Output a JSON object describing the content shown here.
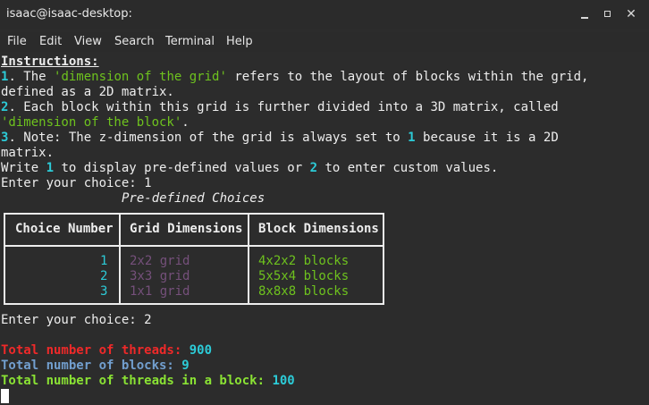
{
  "window": {
    "title": "isaac@isaac-desktop:",
    "close_glyph": "✕"
  },
  "menu": [
    "File",
    "Edit",
    "View",
    "Search",
    "Terminal",
    "Help"
  ],
  "terminal": {
    "instructions_heading": "Instructions:",
    "line1": {
      "num": "1",
      "sep": ". The ",
      "term": "'dimension of the grid'",
      "rest": " refers to the layout of blocks within the grid,"
    },
    "line1b": "defined as a 2D matrix.",
    "line2": {
      "num": "2",
      "rest": ". Each block within this grid is further divided into a 3D matrix, called"
    },
    "line2b": "'dimension of the block'",
    "line2b_end": ".",
    "line3": {
      "num": "3",
      "pre": ". Note: The z-dimension of the grid is always set to ",
      "val": "1",
      "rest": " because it is a 2D"
    },
    "line3b": "matrix.",
    "write_line": {
      "pre": "Write ",
      "one": "1",
      "mid": " to display pre-defined values or ",
      "two": "2",
      "post": " to enter custom values."
    },
    "prompt1": "Enter your choice: 1",
    "table_title": "Pre-defined Choices",
    "table": {
      "headers": [
        "Choice Number",
        "Grid Dimensions",
        "Block Dimensions"
      ],
      "rows": [
        {
          "choice": "1",
          "grid": "2x2 grid",
          "block": "4x2x2 blocks"
        },
        {
          "choice": "2",
          "grid": "3x3 grid",
          "block": "5x5x4 blocks"
        },
        {
          "choice": "3",
          "grid": "1x1 grid",
          "block": "8x8x8 blocks"
        }
      ]
    },
    "prompt2": "Enter your choice: 2",
    "threads_label": "Total number of threads: ",
    "threads_value": "900",
    "blocks_label": "Total number of blocks: ",
    "blocks_value": "9",
    "tpb_label": "Total number of threads in a block: ",
    "tpb_value": "100"
  },
  "colors": {
    "background": "#2c2c2c",
    "cyan": "#2ccbd7",
    "green": "#6ec21e",
    "purple": "#75507b",
    "red": "#ef2929",
    "blue": "#729fcf",
    "light_green": "#8ae234"
  },
  "icons": [
    "minimize-icon",
    "maximize-icon",
    "close-icon"
  ]
}
